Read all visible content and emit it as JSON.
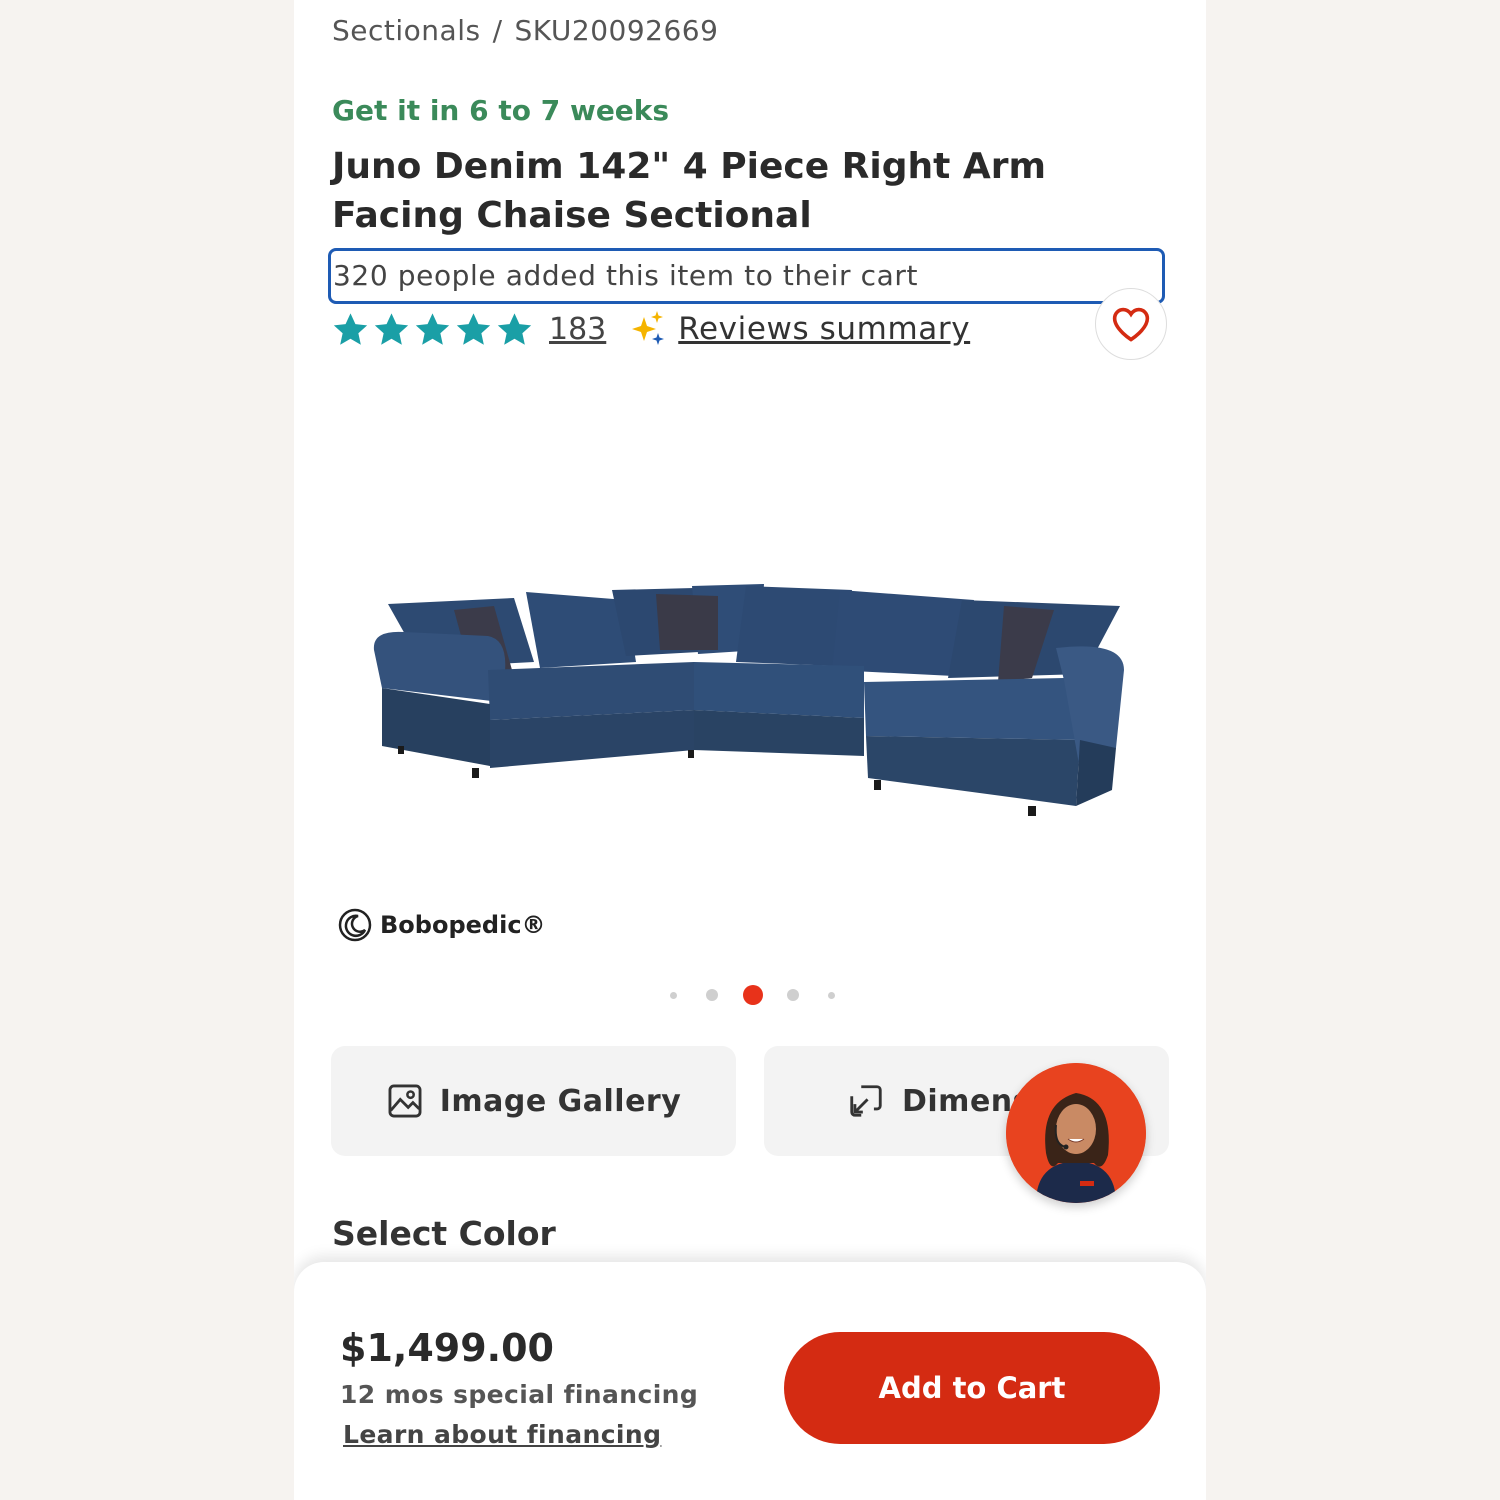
{
  "breadcrumb": {
    "category": "Sectionals",
    "separator": "/",
    "sku": "SKU20092669"
  },
  "delivery": {
    "text": "Get it in 6 to 7 weeks"
  },
  "product": {
    "title": "Juno Denim 142\" 4 Piece Right Arm Facing Chaise Sectional",
    "cart_count_text": "320 people added this item to their cart",
    "rating_stars": 5,
    "review_count": "183",
    "reviews_summary_label": "Reviews summary",
    "brand": "Bobopedic®"
  },
  "carousel": {
    "count": 5,
    "active_index": 2
  },
  "actions": {
    "gallery_label": "Image Gallery",
    "dimensions_label": "Dimens"
  },
  "color_section": {
    "heading": "Select Color"
  },
  "purchase": {
    "price": "$1,499.00",
    "financing_text": "12 mos special financing",
    "financing_link": "Learn about financing",
    "cta_label": "Add to Cart"
  },
  "colors": {
    "accent": "#d42b12",
    "star": "#1a9fa6",
    "delivery_green": "#3b8a5a",
    "highlight_border": "#1e5bb4"
  }
}
